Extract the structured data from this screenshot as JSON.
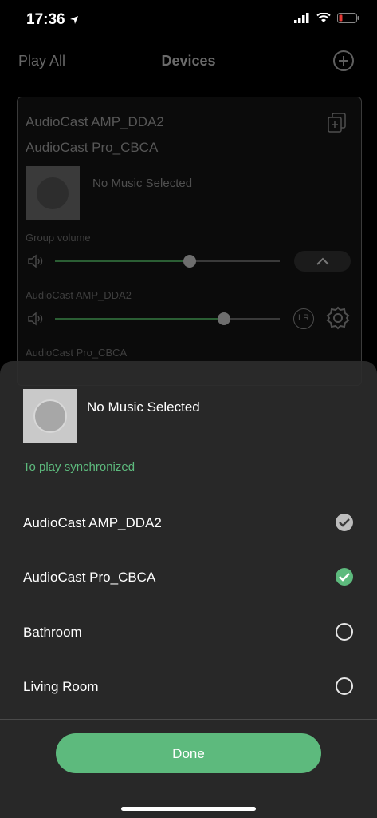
{
  "status": {
    "time": "17:36"
  },
  "header": {
    "play_all": "Play All",
    "title": "Devices"
  },
  "group_card": {
    "device1": "AudioCast AMP_DDA2",
    "device2": "AudioCast Pro_CBCA",
    "now_playing": "No Music Selected",
    "group_volume_label": "Group volume",
    "group_volume_level": 0.6,
    "amp_label": "AudioCast AMP_DDA2",
    "amp_volume_level": 0.75,
    "pro_label": "AudioCast Pro_CBCA",
    "lr_label": "LR"
  },
  "sheet": {
    "now_playing": "No Music Selected",
    "sync_label": "To play synchronized",
    "devices": [
      {
        "name": "AudioCast AMP_DDA2",
        "state": "selected-grey"
      },
      {
        "name": "AudioCast Pro_CBCA",
        "state": "selected-green"
      },
      {
        "name": "Bathroom",
        "state": "unselected"
      },
      {
        "name": "Living Room",
        "state": "unselected"
      }
    ],
    "done_label": "Done"
  },
  "colors": {
    "accent": "#5dba7d",
    "sheet_bg": "#2c2c2c"
  }
}
